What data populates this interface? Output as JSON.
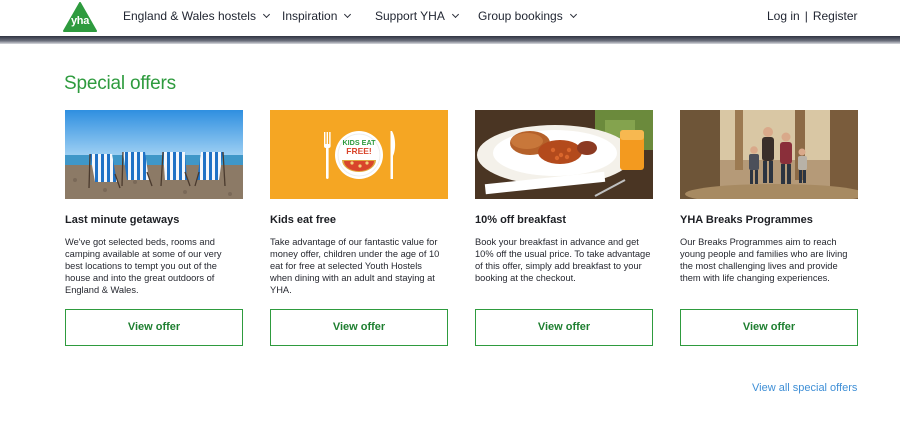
{
  "header": {
    "logo_text": "yha",
    "nav": [
      {
        "label": "England & Wales hostels"
      },
      {
        "label": "Inspiration"
      },
      {
        "label": "Support YHA"
      },
      {
        "label": "Group bookings"
      }
    ],
    "login": "Log in",
    "separator": "|",
    "register": "Register"
  },
  "section": {
    "title": "Special offers",
    "view_all": "View all special offers"
  },
  "offers": [
    {
      "image": "beach-deckchairs-photo",
      "title": "Last minute getaways",
      "text": "We've got selected beds, rooms and camping available at some of our very best locations to tempt you out of the house and into the great outdoors of England & Wales.",
      "button": "View offer"
    },
    {
      "image": "kids-eat-free-plate-graphic",
      "image_text_line1": "KIDS EAT",
      "image_text_line2": "FREE!",
      "title": "Kids eat free",
      "text": "Take advantage of our fantastic value for money offer, children under the age of 10 eat for free at selected Youth Hostels when dining with an adult and staying at YHA.",
      "button": "View offer"
    },
    {
      "image": "breakfast-plate-photo",
      "title": "10% off breakfast",
      "text": "Book your breakfast in advance and get 10% off the usual price. To take advantage of this offer, simply add breakfast to your booking at the checkout.",
      "button": "View offer"
    },
    {
      "image": "family-walk-forest-photo",
      "title": "YHA Breaks Programmes",
      "text": "Our Breaks Programmes aim to reach young people and families who are living the most challenging lives and provide them with life changing experiences.",
      "button": "View offer"
    }
  ],
  "colors": {
    "brand_green": "#2e9b3e",
    "link_blue": "#3f8fd6",
    "header_bar": "#2f3341"
  }
}
